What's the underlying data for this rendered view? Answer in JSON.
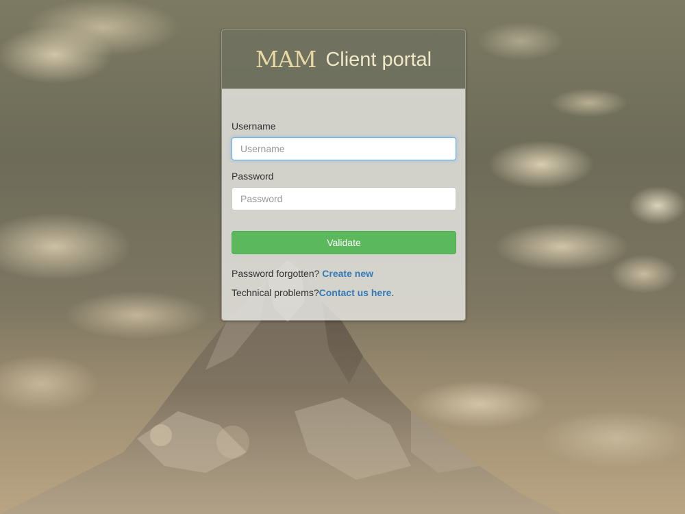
{
  "header": {
    "logo_text": "MAM",
    "title": "Client portal"
  },
  "form": {
    "username_label": "Username",
    "username_placeholder": "Username",
    "username_value": "",
    "password_label": "Password",
    "password_placeholder": "Password",
    "password_value": "",
    "submit_label": "Validate"
  },
  "help": {
    "forgot_text": "Password forgotten? ",
    "forgot_link": "Create new",
    "tech_text": "Technical problems?",
    "contact_link": "Contact us here",
    "contact_suffix": "."
  },
  "colors": {
    "accent_green": "#5cb85c",
    "link_blue": "#337ab7",
    "logo_gold": "#e6d9a4"
  },
  "icons": {
    "logo": "mountain-logo-icon"
  }
}
